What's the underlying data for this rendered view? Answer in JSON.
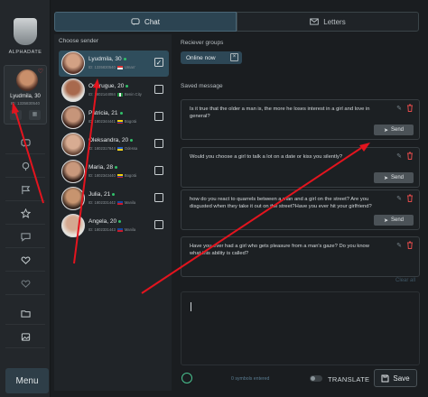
{
  "sidebar": {
    "logo_text": "ALPHADATE",
    "profile": {
      "name": "Lyudmila, 30",
      "id": "ID: 1335830540"
    },
    "menu_label": "Menu",
    "nav_icons": [
      "chat-bubble-icon",
      "location-pin-icon",
      "flag-icon",
      "star-icon",
      "message-icon",
      "heart-plus-icon",
      "heart-outline-icon",
      "folder-icon",
      "image-icon"
    ]
  },
  "tabs": {
    "chat": "Chat",
    "letters": "Letters"
  },
  "senders": {
    "label": "Choose sender",
    "items": [
      {
        "name": "Lyudmila, 30",
        "id": "ID: 1335830540",
        "city": "Uman'",
        "checked": true
      },
      {
        "name": "Osarugue, 20",
        "id": "ID: 1802144084",
        "city": "Benin City",
        "checked": false
      },
      {
        "name": "Patricia, 21",
        "id": "ID: 1802344441",
        "city": "Bogotá",
        "checked": false
      },
      {
        "name": "Oleksandra, 20",
        "id": "ID: 1802317844",
        "city": "Odessa",
        "checked": false
      },
      {
        "name": "Maria, 28",
        "id": "ID: 1802343440",
        "city": "Bogotá",
        "checked": false
      },
      {
        "name": "Julia, 21",
        "id": "ID: 1802331442",
        "city": "Manila",
        "checked": false
      },
      {
        "name": "Angela, 20",
        "id": "ID: 1802331443",
        "city": "Manila",
        "checked": false
      }
    ]
  },
  "receivers": {
    "label": "Reciever groups",
    "chip": "Online now"
  },
  "saved": {
    "label": "Saved message",
    "send_label": "Send",
    "messages": [
      "Is it true that the older a man is, the more he loses interest in a girl and love in general?",
      "Would you choose a girl to talk a lot on a date or kiss you silently?",
      "how do you react to quarrels between a man and a girl on the street? Are you disgusted when they take it out on the street?Have you ever hit your girlfriend?",
      "Have you ever had a girl who gets pleasure from a man's gaze? Do you know what this ability is called?"
    ],
    "clear_all": "Clear all"
  },
  "compose": {
    "symbols": "0 symbols entered",
    "translate": "TRANSLATE",
    "save": "Save"
  },
  "colors": {
    "accent": "#2c4452",
    "selected_row": "#2f4d5c",
    "annotation": "#e3141e",
    "online": "#31c06a"
  }
}
